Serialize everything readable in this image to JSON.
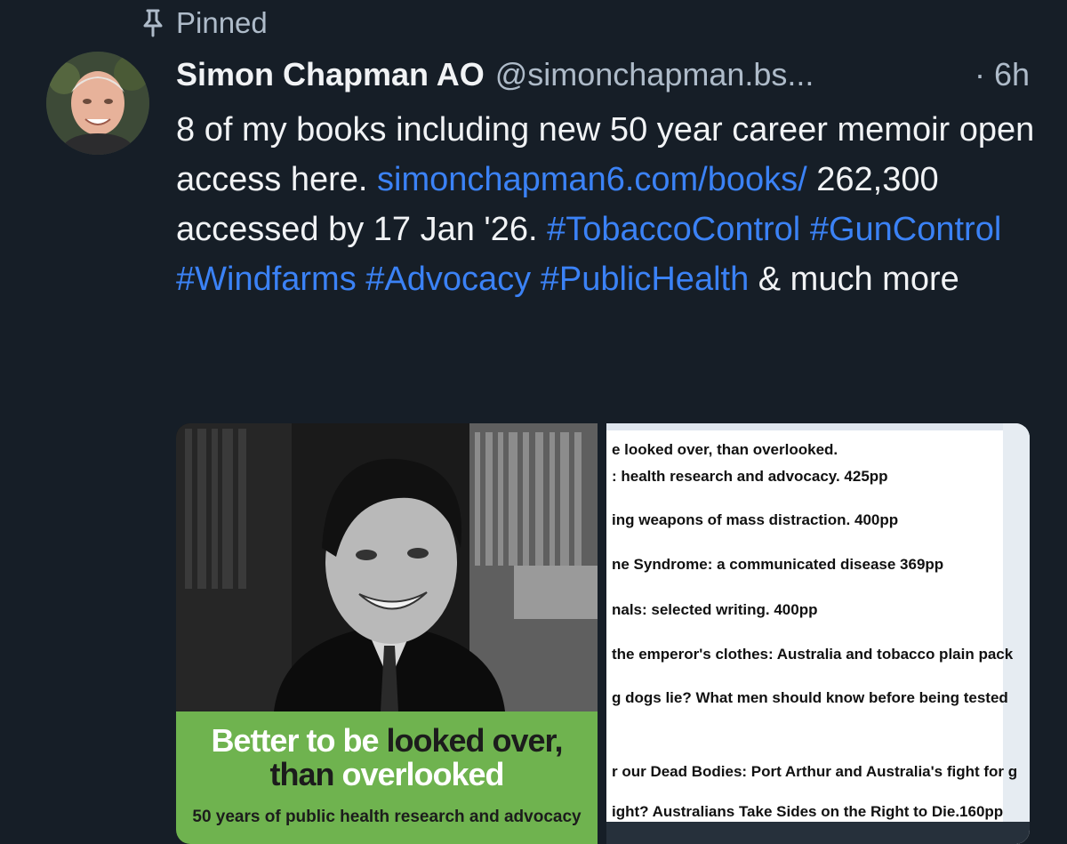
{
  "pinned_label": "Pinned",
  "author": {
    "display_name": "Simon Chapman AO",
    "handle": "@simonchapman.bs...",
    "time": "· 6h"
  },
  "post": {
    "text_1": "8 of my books including new 50 year career memoir open access here.",
    "link": "simonchapman6.com/books/",
    "text_2": " 262,300 accessed by 17 Jan '26. ",
    "tags": [
      "#TobaccoControl",
      "#GunControl",
      "#Windfarms",
      "#Advocacy",
      "#PublicHealth"
    ],
    "text_3": " & much more"
  },
  "media": {
    "cover": {
      "title_line1_a": "Better to be ",
      "title_line1_b": "looked over,",
      "title_line2_a": "than ",
      "title_line2_b": "overlooked",
      "subtitle": "50 years of public health research and advocacy"
    },
    "list_lines": [
      "e looked over, than overlooked.",
      ": health research and advocacy. 425pp",
      "ing weapons of mass distraction. 400pp",
      "ne Syndrome: a communicated disease 369pp",
      "nals: selected writing. 400pp",
      " the emperor's clothes: Australia and tobacco plain pack",
      "g dogs lie? What men should know before being tested",
      "r our Dead Bodies: Port Arthur and Australia's fight for g",
      "ight? Australians Take Sides on the Right to Die.160pp"
    ]
  },
  "colors": {
    "background": "#161e27",
    "link": "#3b82f6",
    "muted": "#aebbc9",
    "cover_green": "#6fb34f"
  },
  "icons": {
    "pin": "pin-icon"
  }
}
